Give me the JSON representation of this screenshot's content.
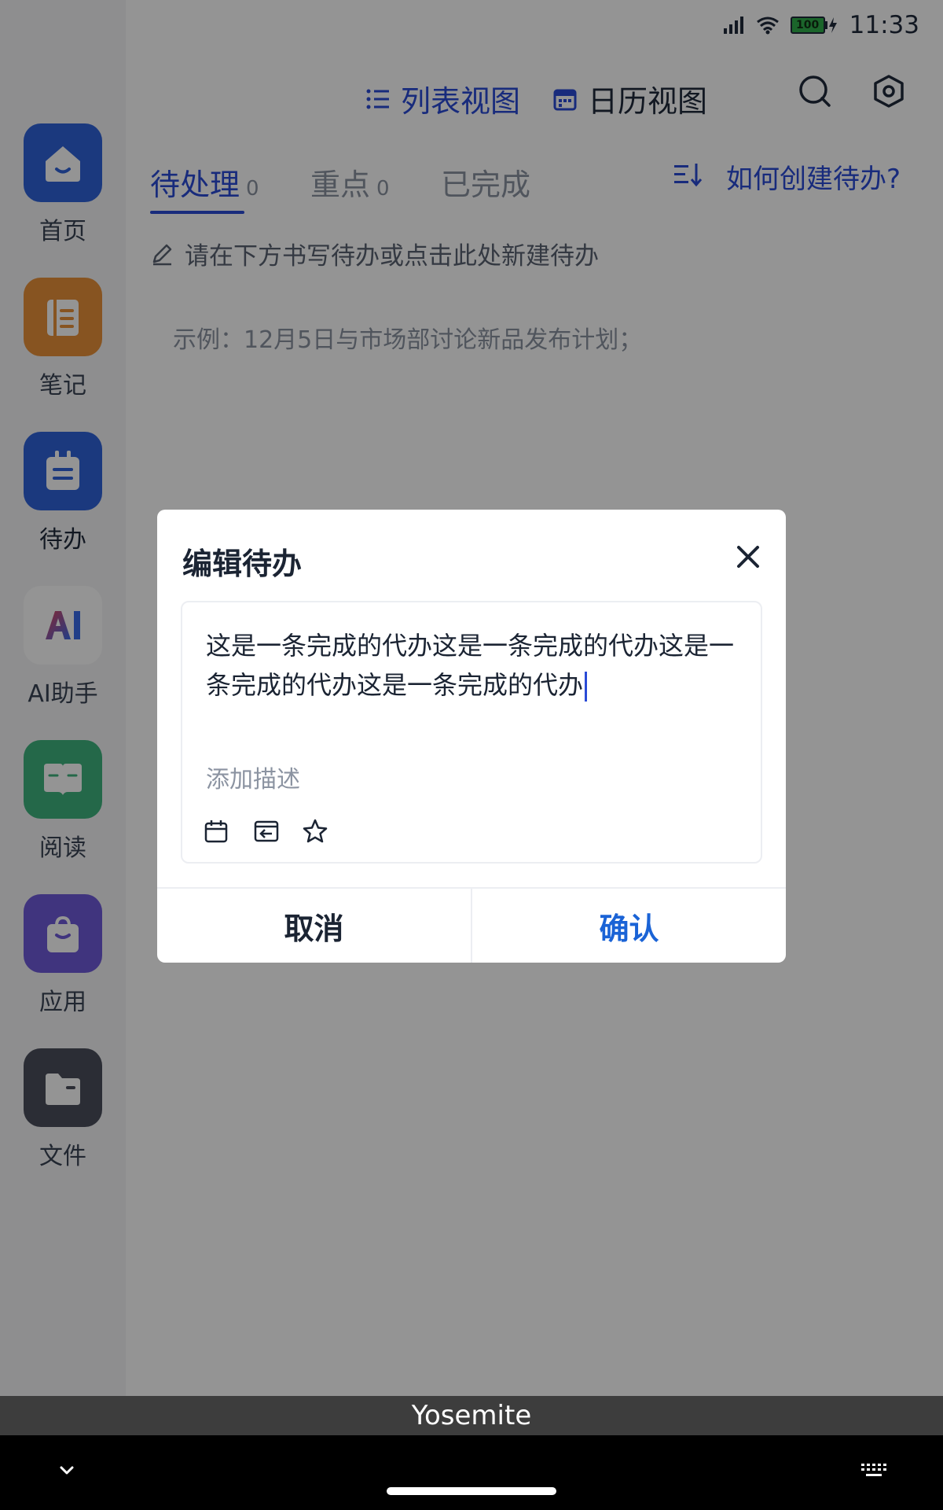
{
  "status_bar": {
    "time": "11:33",
    "battery": "100"
  },
  "header": {
    "list_view": "列表视图",
    "calendar_view": "日历视图",
    "icons": [
      "search-icon",
      "settings-icon"
    ]
  },
  "sidebar": {
    "items": [
      {
        "label": "首页",
        "icon": "home-icon",
        "color": "#2f63d9"
      },
      {
        "label": "笔记",
        "icon": "notebook-icon",
        "color": "#e8923a"
      },
      {
        "label": "待办",
        "icon": "todo-icon",
        "color": "#2f63d9"
      },
      {
        "label": "AI助手",
        "icon": "ai-icon",
        "color": "#ffffff"
      },
      {
        "label": "阅读",
        "icon": "book-icon",
        "color": "#3fb37f"
      },
      {
        "label": "应用",
        "icon": "apps-bag-icon",
        "color": "#6f5bd9"
      },
      {
        "label": "文件",
        "icon": "folder-icon",
        "color": "#4a4f5c"
      }
    ],
    "active": "待办"
  },
  "tabs": [
    {
      "label": "待处理",
      "count": "0"
    },
    {
      "label": "重点",
      "count": "0"
    },
    {
      "label": "已完成",
      "count": ""
    }
  ],
  "howto_link": "如何创建待办?",
  "new_hint": "请在下方书写待办或点击此处新建待办",
  "example": "示例：12月5日与市场部讨论新品发布计划；",
  "dialog": {
    "title": "编辑待办",
    "todo_text": "这是一条完成的代办这是一条完成的代办这是一条完成的代办这是一条完成的代办",
    "description_placeholder": "添加描述",
    "tools": [
      "calendar-icon",
      "move-to-icon",
      "star-icon"
    ],
    "cancel": "取消",
    "confirm": "确认"
  },
  "device_bar": {
    "label": "Yosemite"
  },
  "colors": {
    "accent": "#2a4bd6",
    "confirm": "#1a63d6"
  }
}
